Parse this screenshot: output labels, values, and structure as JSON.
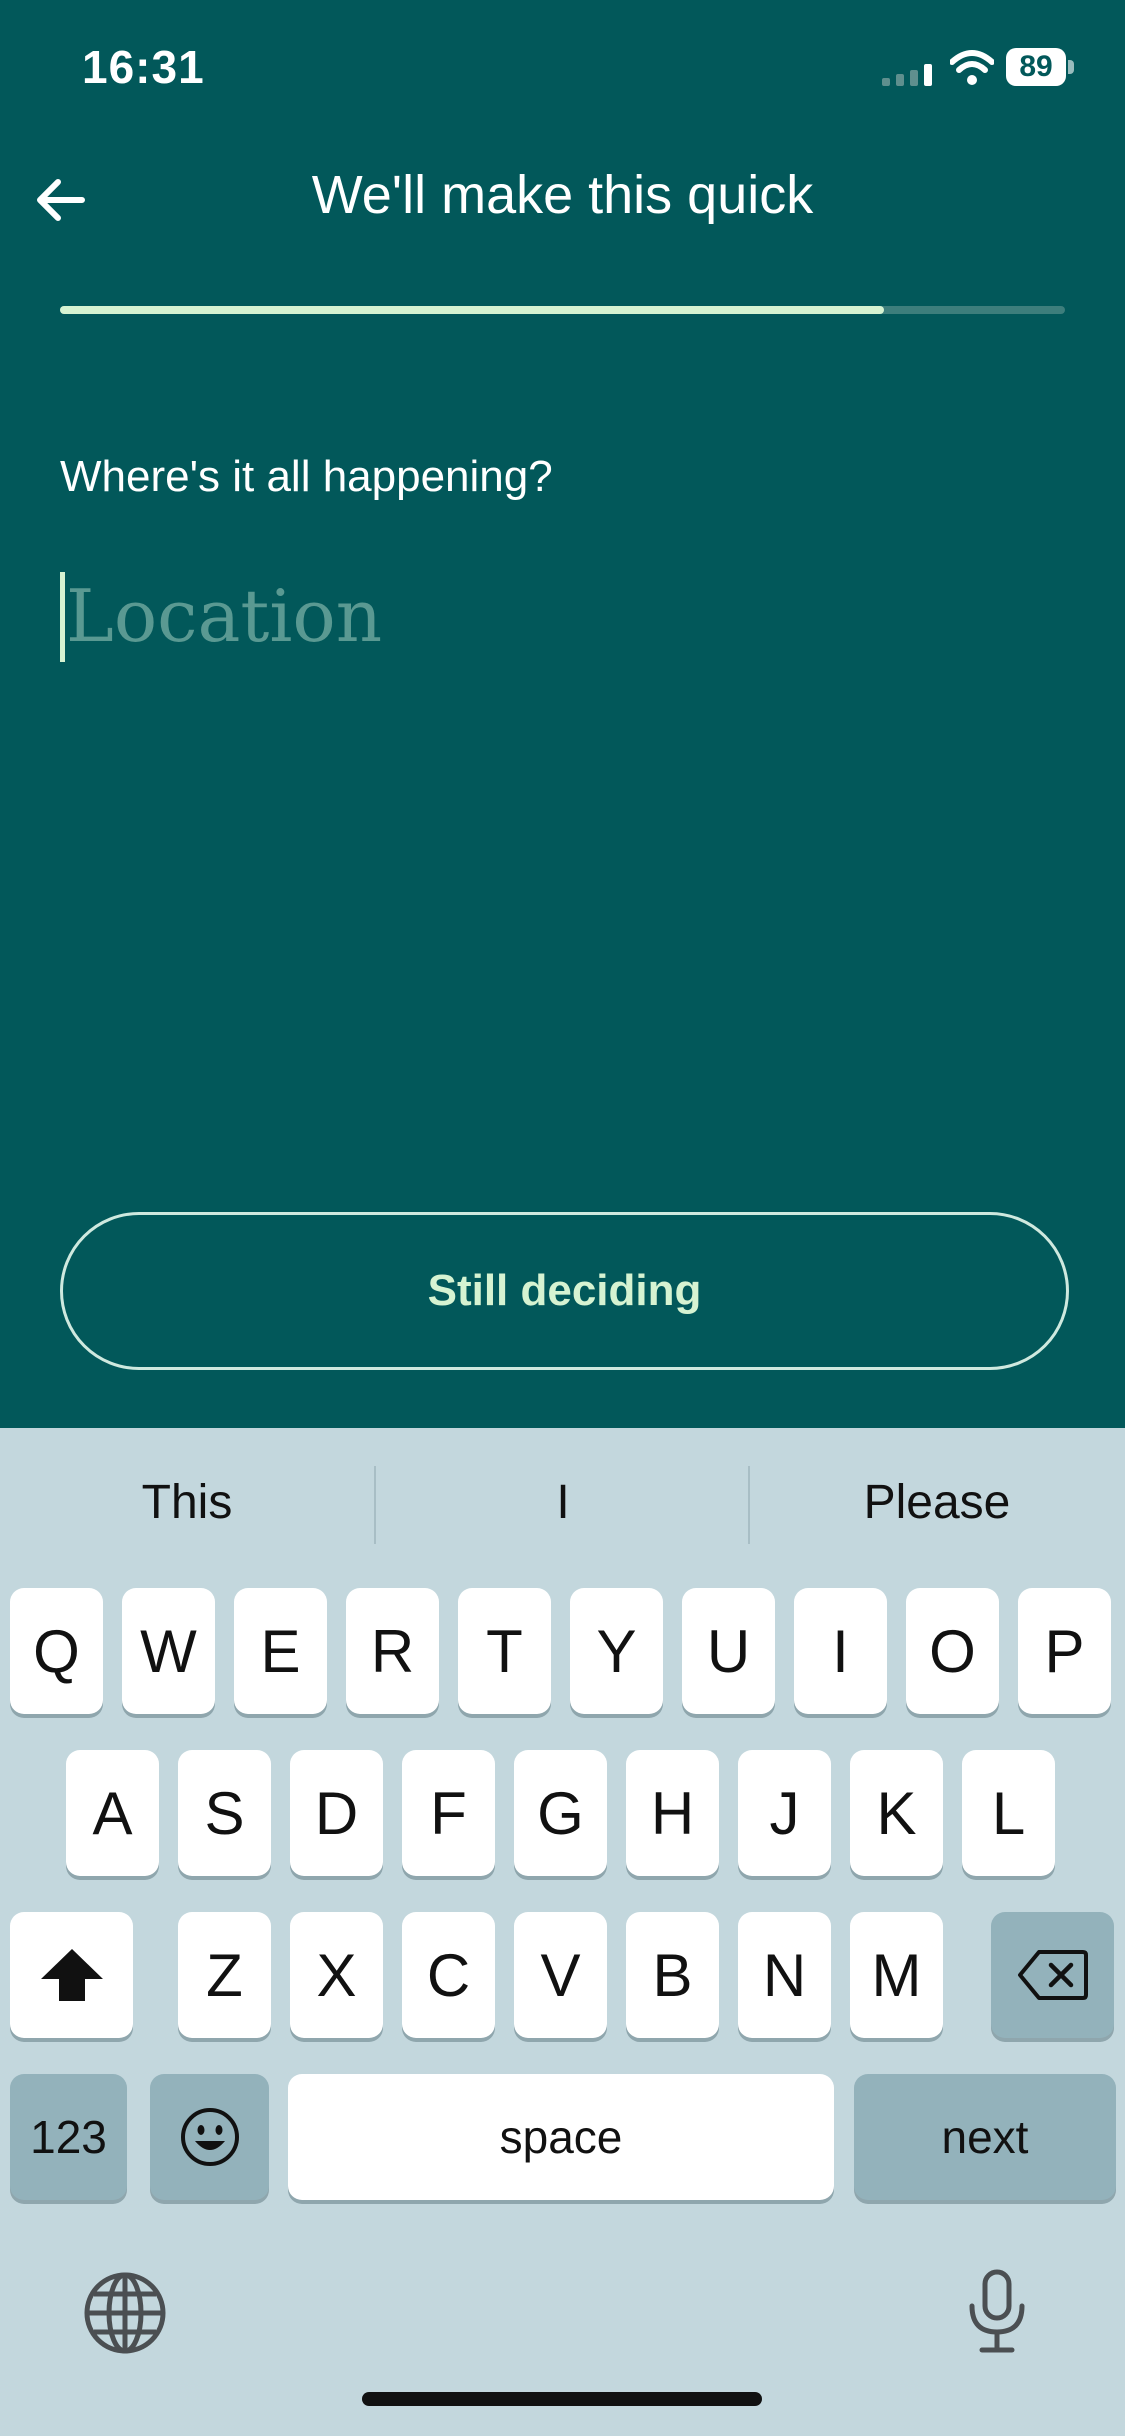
{
  "status_bar": {
    "time": "16:31",
    "battery": "89"
  },
  "header": {
    "title": "We'll make this quick"
  },
  "progress": {
    "fraction": 0.82
  },
  "form": {
    "question": "Where's it all happening?",
    "location_placeholder": "Location",
    "location_value": ""
  },
  "actions": {
    "still_deciding_label": "Still deciding"
  },
  "keyboard": {
    "suggestions": [
      "This",
      "I",
      "Please"
    ],
    "row1": [
      "Q",
      "W",
      "E",
      "R",
      "T",
      "Y",
      "U",
      "I",
      "O",
      "P"
    ],
    "row2": [
      "A",
      "S",
      "D",
      "F",
      "G",
      "H",
      "J",
      "K",
      "L"
    ],
    "row3": [
      "Z",
      "X",
      "C",
      "V",
      "B",
      "N",
      "M"
    ],
    "numbers_label": "123",
    "space_label": "space",
    "next_label": "next"
  },
  "icons": {
    "back": "arrow-left-icon",
    "wifi": "wifi-icon",
    "signal": "signal-icon",
    "shift": "shift-icon",
    "backspace": "backspace-icon",
    "emoji": "emoji-icon",
    "globe": "globe-icon",
    "mic": "mic-icon"
  },
  "colors": {
    "background": "#02585A",
    "accent": "#D6F3D2",
    "keyboard_bg": "#C3D7DD",
    "key_gray": "#93B2BB"
  }
}
